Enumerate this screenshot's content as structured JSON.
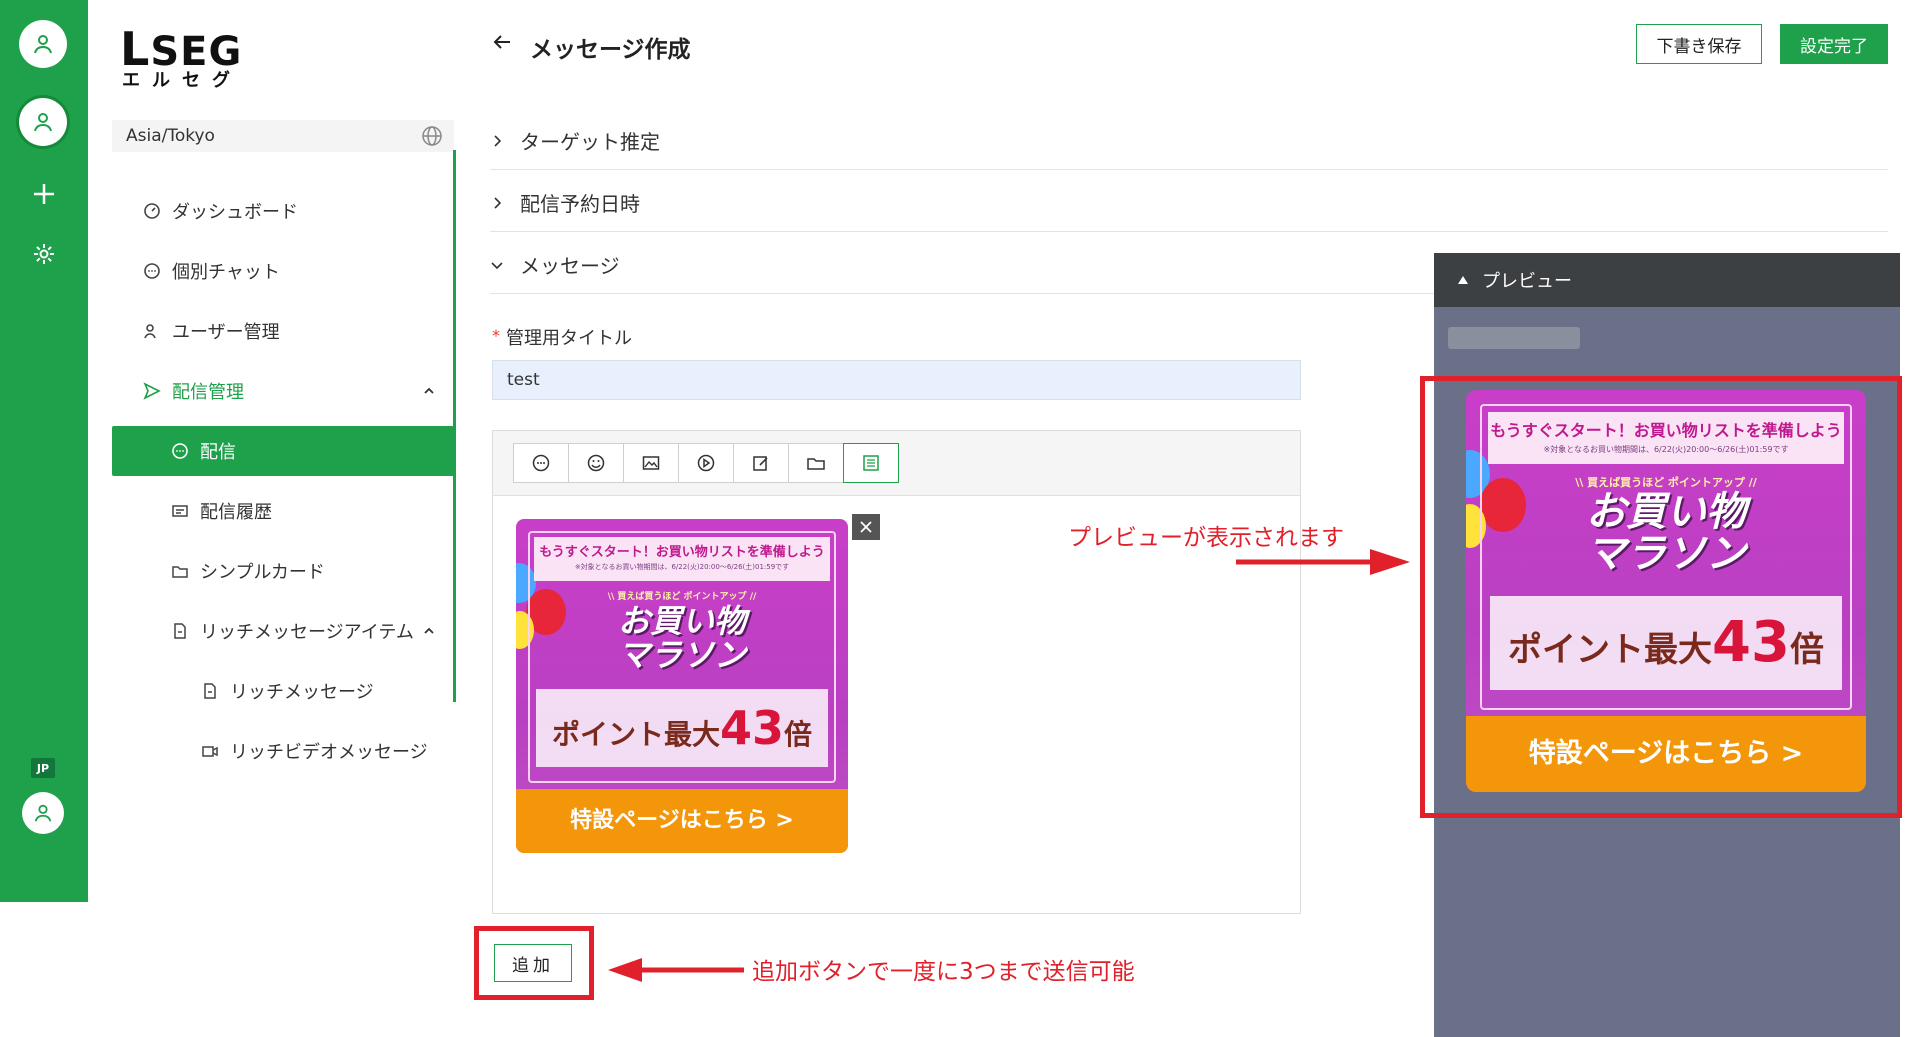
{
  "app": {
    "logo_main": "SEG",
    "logo_l": "L",
    "logo_sub": "エルセグ",
    "timezone": "Asia/Tokyo",
    "lang_badge": "JP"
  },
  "sidebar": {
    "items": [
      {
        "label": "ダッシュボード",
        "icon": "dashboard-icon"
      },
      {
        "label": "個別チャット",
        "icon": "chat-icon"
      },
      {
        "label": "ユーザー管理",
        "icon": "users-icon"
      },
      {
        "label": "配信管理",
        "icon": "send-icon"
      },
      {
        "label": "配信",
        "icon": "chat-icon"
      },
      {
        "label": "配信履歴",
        "icon": "history-icon"
      },
      {
        "label": "シンプルカード",
        "icon": "folder-icon"
      },
      {
        "label": "リッチメッセージアイテム",
        "icon": "document-icon"
      },
      {
        "label": "リッチメッセージ",
        "icon": "document-icon"
      },
      {
        "label": "リッチビデオメッセージ",
        "icon": "video-icon"
      }
    ]
  },
  "header": {
    "title": "メッセージ作成",
    "draft_label": "下書き保存",
    "done_label": "設定完了"
  },
  "sections": [
    {
      "label": "ターゲット推定",
      "expanded": false
    },
    {
      "label": "配信予約日時",
      "expanded": false
    },
    {
      "label": "メッセージ",
      "expanded": true
    }
  ],
  "form": {
    "required_mark": "*",
    "title_label": "管理用タイトル",
    "title_value": "test"
  },
  "toolbar": {
    "buttons": [
      "text-icon",
      "sticker-icon",
      "image-icon",
      "video-icon",
      "edit-icon",
      "folder-icon",
      "richmessage-icon"
    ],
    "active_index": 6
  },
  "banner": {
    "headline": "もうすぐスタート！お買い物リストを準備しよう",
    "fine_print": "※対象となるお買い物期間は、6/22(火)20:00〜6/26(土)01:59です",
    "sub": "\\\\ 買えば買うほど ポイントアップ //",
    "big_line1": "お買い物",
    "big_line2": "マラソン",
    "point_prefix": "ポイント最大",
    "point_num": "43",
    "point_suffix": "倍",
    "cta": "特設ページはこちら >"
  },
  "add_button": "追加",
  "annotations": {
    "add_note": "追加ボタンで一度に3つまで送信可能",
    "preview_note": "プレビューが表示されます"
  },
  "preview": {
    "header": "プレビュー"
  },
  "colors": {
    "brand_green": "#1fa04a",
    "annotation_red": "#e0202a",
    "cta_orange": "#f4960a",
    "banner_magenta": "#c93ec8"
  }
}
